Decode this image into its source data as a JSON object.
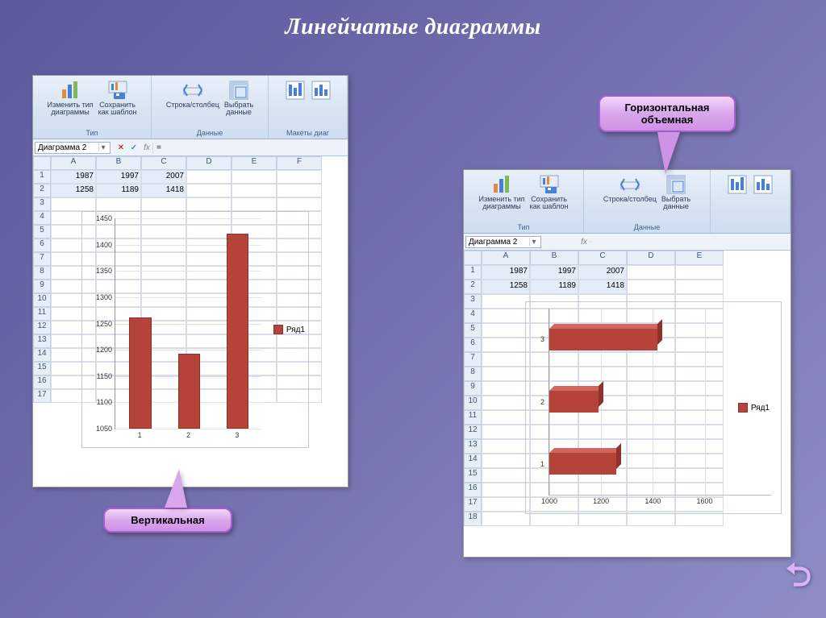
{
  "title": "Линейчатые  диаграммы",
  "callout_top": "Горизонтальная\nобъемная",
  "callout_bottom": "Вертикальная",
  "uturn": "⮌",
  "ribbon": {
    "change_type": "Изменить тип\nдиаграммы",
    "save_template": "Сохранить\nкак шаблон",
    "switch_rowcol": "Строка/столбец",
    "select_data": "Выбрать\nданные",
    "group_type": "Тип",
    "group_data": "Данные",
    "group_layouts": "Макеты диаг"
  },
  "namebox": "Диаграмма 2",
  "fx_equals": "=",
  "fx_label": "fx",
  "col_headers": [
    "A",
    "B",
    "C",
    "D",
    "E",
    "F"
  ],
  "col_headers_r": [
    "A",
    "B",
    "C",
    "D",
    "E"
  ],
  "rows_left": [
    "1",
    "2",
    "3",
    "4",
    "5",
    "6",
    "7",
    "8",
    "9",
    "10",
    "11",
    "12",
    "13",
    "14",
    "15",
    "16",
    "17"
  ],
  "rows_right": [
    "1",
    "2",
    "3",
    "4",
    "5",
    "6",
    "7",
    "8",
    "9",
    "10",
    "11",
    "12",
    "13",
    "14",
    "15",
    "16",
    "17",
    "18"
  ],
  "data_row1": [
    "1987",
    "1997",
    "2007"
  ],
  "data_row2": [
    "1258",
    "1189",
    "1418"
  ],
  "legend": "Ряд1",
  "chart_data": [
    {
      "type": "bar",
      "orientation": "vertical",
      "categories": [
        "1",
        "2",
        "3"
      ],
      "values": [
        1258,
        1189,
        1418
      ],
      "series_name": "Ряд1",
      "ylim": [
        1050,
        1450
      ],
      "yticks": [
        1050,
        1100,
        1150,
        1200,
        1250,
        1300,
        1350,
        1400,
        1450
      ]
    },
    {
      "type": "bar",
      "orientation": "horizontal-3d",
      "categories": [
        "1",
        "2",
        "3"
      ],
      "values": [
        1258,
        1189,
        1418
      ],
      "series_name": "Ряд1",
      "xlim": [
        1000,
        1600
      ],
      "xticks": [
        1000,
        1200,
        1400,
        1600
      ]
    }
  ]
}
